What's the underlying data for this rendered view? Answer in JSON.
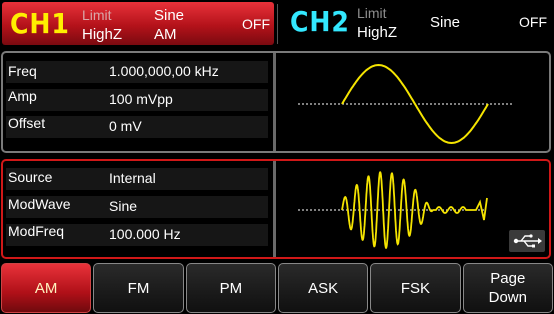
{
  "ch1": {
    "name": "CH1",
    "limit": "Limit",
    "load": "HighZ",
    "waveform": "Sine",
    "mode": "AM",
    "state": "OFF"
  },
  "ch2": {
    "name": "CH2",
    "limit": "Limit",
    "load": "HighZ",
    "waveform": "Sine",
    "state": "OFF"
  },
  "carrier": {
    "params": [
      {
        "label": "Freq",
        "value": "1.000,000,00 kHz"
      },
      {
        "label": "Amp",
        "value": "100 mVpp"
      },
      {
        "label": "Offset",
        "value": "0 mV"
      }
    ],
    "preview": "sine"
  },
  "modulation": {
    "params": [
      {
        "label": "Source",
        "value": "Internal"
      },
      {
        "label": "ModWave",
        "value": "Sine"
      },
      {
        "label": "ModFreq",
        "value": "100.000 Hz"
      }
    ],
    "preview": "am-modulated-sine"
  },
  "colors": {
    "ch1_accent": "#d01818",
    "ch1_name": "#fff000",
    "ch2_name": "#33e8ff",
    "wave": "#f5e400"
  },
  "softkeys": [
    {
      "label": "AM",
      "active": true
    },
    {
      "label": "FM",
      "active": false
    },
    {
      "label": "PM",
      "active": false
    },
    {
      "label": "ASK",
      "active": false
    },
    {
      "label": "FSK",
      "active": false
    },
    {
      "label": "Page Down",
      "active": false
    }
  ],
  "usb_icon": "usb-icon"
}
